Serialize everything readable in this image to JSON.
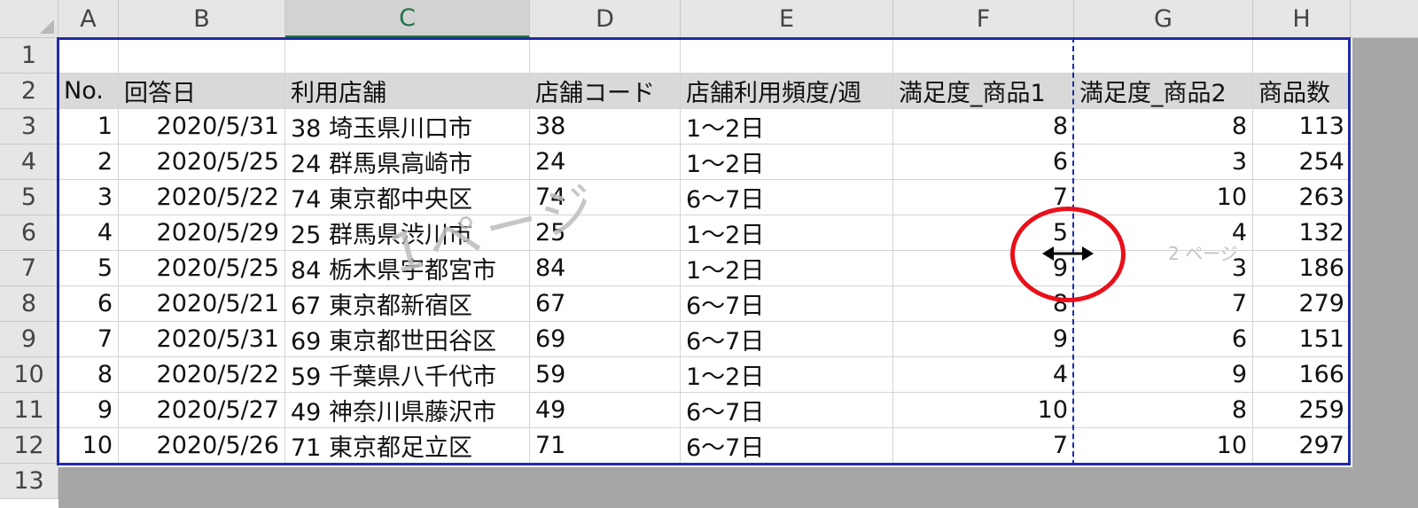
{
  "sheet": {
    "columns": [
      "A",
      "B",
      "C",
      "D",
      "E",
      "F",
      "G",
      "H"
    ],
    "active_column": "C",
    "rows": [
      "1",
      "2",
      "3",
      "4",
      "5",
      "6",
      "7",
      "8",
      "9",
      "10",
      "11",
      "12",
      "13"
    ],
    "headers": [
      "No.",
      "回答日",
      "利用店舗",
      "店舗コード",
      "店舗利用頻度/週",
      "満足度_商品1",
      "満足度_商品2",
      "商品数"
    ],
    "data": [
      [
        "1",
        "2020/5/31",
        "38 埼玉県川口市",
        "38",
        "1～2日",
        "8",
        "8",
        "113"
      ],
      [
        "2",
        "2020/5/25",
        "24 群馬県高崎市",
        "24",
        "1～2日",
        "6",
        "3",
        "254"
      ],
      [
        "3",
        "2020/5/22",
        "74 東京都中央区",
        "74",
        "6～7日",
        "7",
        "10",
        "263"
      ],
      [
        "4",
        "2020/5/29",
        "25 群馬県渋川市",
        "25",
        "1～2日",
        "5",
        "4",
        "132"
      ],
      [
        "5",
        "2020/5/25",
        "84 栃木県宇都宮市",
        "84",
        "1～2日",
        "9",
        "3",
        "186"
      ],
      [
        "6",
        "2020/5/21",
        "67 東京都新宿区",
        "67",
        "6～7日",
        "8",
        "7",
        "279"
      ],
      [
        "7",
        "2020/5/31",
        "69 東京都世田谷区",
        "69",
        "6～7日",
        "9",
        "6",
        "151"
      ],
      [
        "8",
        "2020/5/22",
        "59 千葉県八千代市",
        "59",
        "1～2日",
        "4",
        "9",
        "166"
      ],
      [
        "9",
        "2020/5/27",
        "49 神奈川県藤沢市",
        "49",
        "6～7日",
        "10",
        "8",
        "259"
      ],
      [
        "10",
        "2020/5/26",
        "71 東京都足立区",
        "71",
        "6～7日",
        "7",
        "10",
        "297"
      ]
    ]
  },
  "watermarks": {
    "page1": "1ページ",
    "page2": "2 ページ"
  },
  "cursor": {
    "icon": "horizontal-resize-cursor-icon"
  },
  "colors": {
    "page_border": "#1f2aa8",
    "highlight": "#e8101a",
    "active_column": "#217346"
  }
}
